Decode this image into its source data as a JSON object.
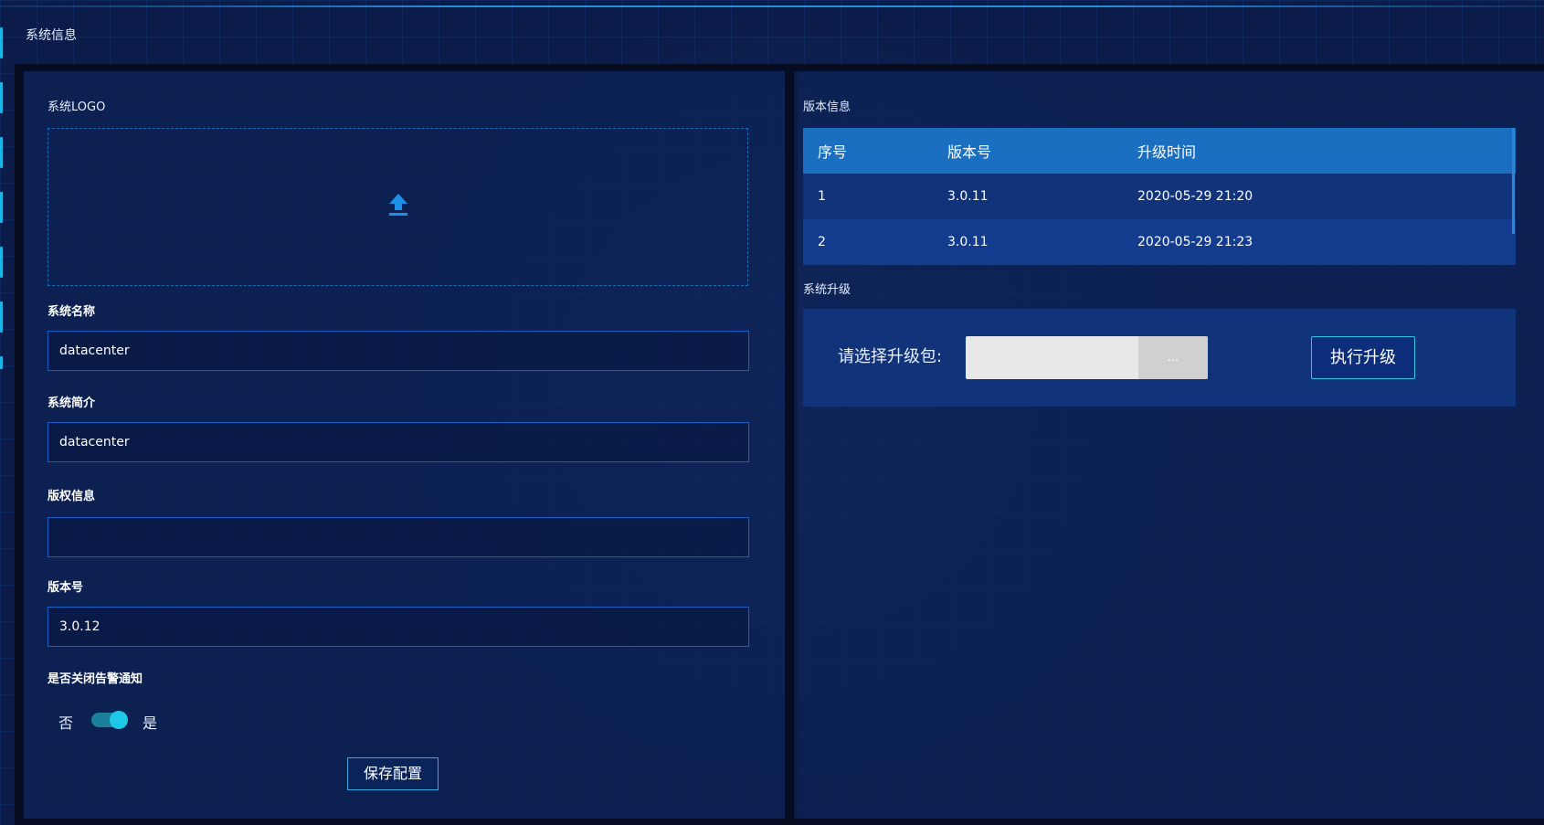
{
  "header": {
    "title": "系统信息"
  },
  "left_panel": {
    "logo_label": "系统LOGO",
    "name_label": "系统名称",
    "name_value": "datacenter",
    "intro_label": "系统简介",
    "intro_value": "datacenter",
    "copyright_label": "版权信息",
    "copyright_value": "",
    "version_label": "版本号",
    "version_value": "3.0.12",
    "alarm_label": "是否关闭告警通知",
    "toggle_off_label": "否",
    "toggle_on_label": "是",
    "toggle_state": "on",
    "save_label": "保存配置"
  },
  "right_panel": {
    "version_info_label": "版本信息",
    "table": {
      "columns": [
        "序号",
        "版本号",
        "升级时间"
      ],
      "rows": [
        [
          "1",
          "3.0.11",
          "2020-05-29 21:20"
        ],
        [
          "2",
          "3.0.11",
          "2020-05-29 21:23"
        ]
      ]
    },
    "upgrade_label": "系统升级",
    "select_package_label": "请选择升级包:",
    "browse_label": "...",
    "execute_label": "执行升级"
  },
  "colors": {
    "accent": "#1fc8e6",
    "table_header": "#1a6fc0",
    "field_border": "#1a5fc4"
  },
  "icons": {
    "upload": "upload-icon"
  }
}
